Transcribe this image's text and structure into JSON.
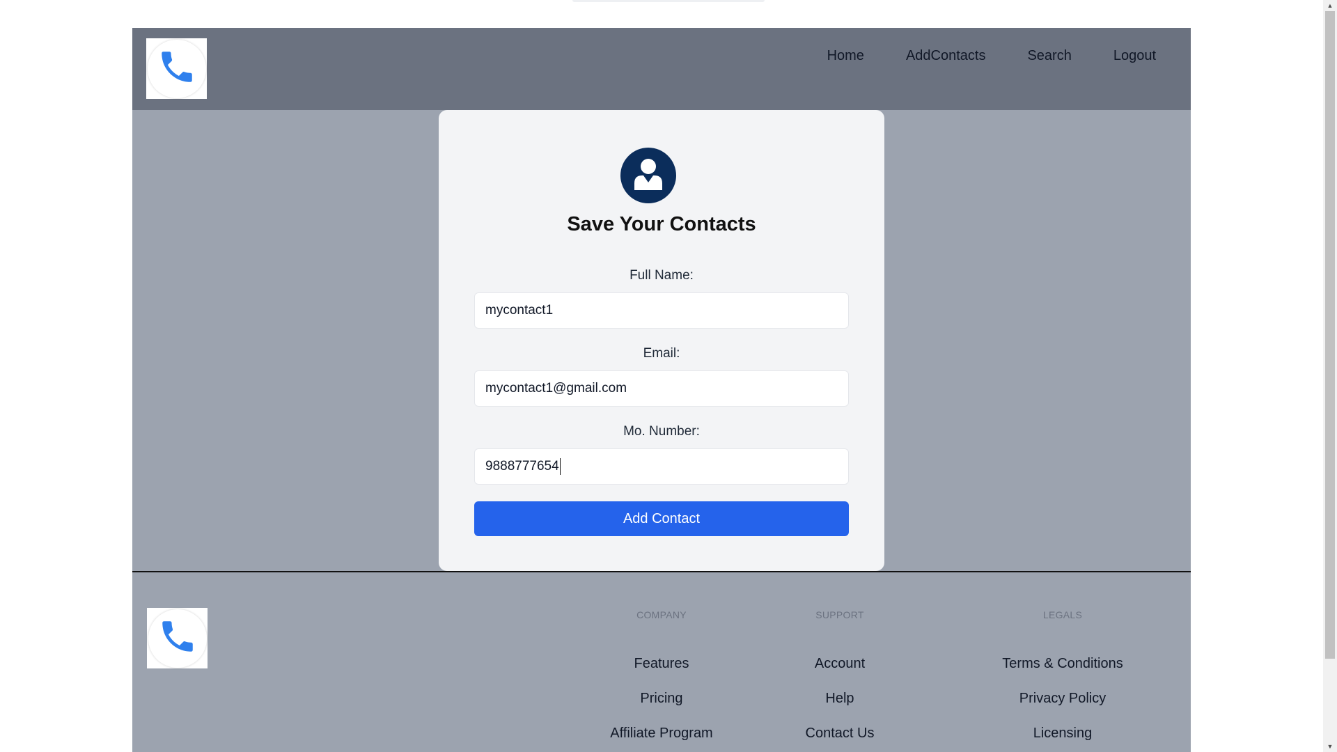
{
  "navbar": {
    "logo_icon": "phone-icon",
    "links": [
      "Home",
      "AddContacts",
      "Search",
      "Logout"
    ]
  },
  "form": {
    "avatar_icon": "user-avatar-icon",
    "title": "Save Your Contacts",
    "full_name_label": "Full Name:",
    "full_name_value": "mycontact1",
    "email_label": "Email:",
    "email_value": "mycontact1@gmail.com",
    "mobile_label": "Mo. Number:",
    "mobile_value": "9888777654",
    "submit_label": "Add Contact"
  },
  "footer": {
    "logo_icon": "phone-icon",
    "columns": [
      {
        "title": "COMPANY",
        "links": [
          "Features",
          "Pricing",
          "Affiliate Program"
        ]
      },
      {
        "title": "SUPPORT",
        "links": [
          "Account",
          "Help",
          "Contact Us"
        ]
      },
      {
        "title": "LEGALS",
        "links": [
          "Terms & Conditions",
          "Privacy Policy",
          "Licensing"
        ]
      }
    ]
  },
  "colors": {
    "navbar": "#6b7280",
    "page": "#9ca3af",
    "card": "#f3f4f6",
    "avatar": "#0b2d5b",
    "button": "#2563eb",
    "phone": "#2f80ed"
  }
}
